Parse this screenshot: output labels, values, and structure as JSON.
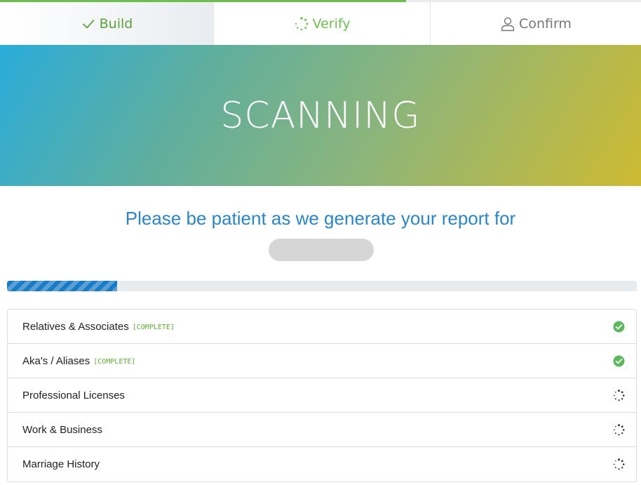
{
  "progress_line": {
    "fraction": 0.633
  },
  "tabs": [
    {
      "label": "Build",
      "icon": "checkmark-icon",
      "state": "done"
    },
    {
      "label": "Verify",
      "icon": "spinner-icon",
      "state": "active"
    },
    {
      "label": "Confirm",
      "icon": "user-icon",
      "state": "pending"
    }
  ],
  "hero": {
    "title": "SCANNING"
  },
  "subtitle": "Please be patient as we generate your report for",
  "scan_progress": {
    "fraction": 0.175
  },
  "items": [
    {
      "label": "Relatives & Associates",
      "status": "[COMPLETE]",
      "icon": "check-circle-icon"
    },
    {
      "label": "Aka's / Aliases",
      "status": "[COMPLETE]",
      "icon": "check-circle-icon"
    },
    {
      "label": "Professional Licenses",
      "status": "",
      "icon": "spinner-icon"
    },
    {
      "label": "Work & Business",
      "status": "",
      "icon": "spinner-icon"
    },
    {
      "label": "Marriage History",
      "status": "",
      "icon": "spinner-icon"
    }
  ],
  "colors": {
    "accent_green": "#6cbf4d",
    "accent_blue": "#2a86c6",
    "progress_blue": "#1a7cc4"
  }
}
